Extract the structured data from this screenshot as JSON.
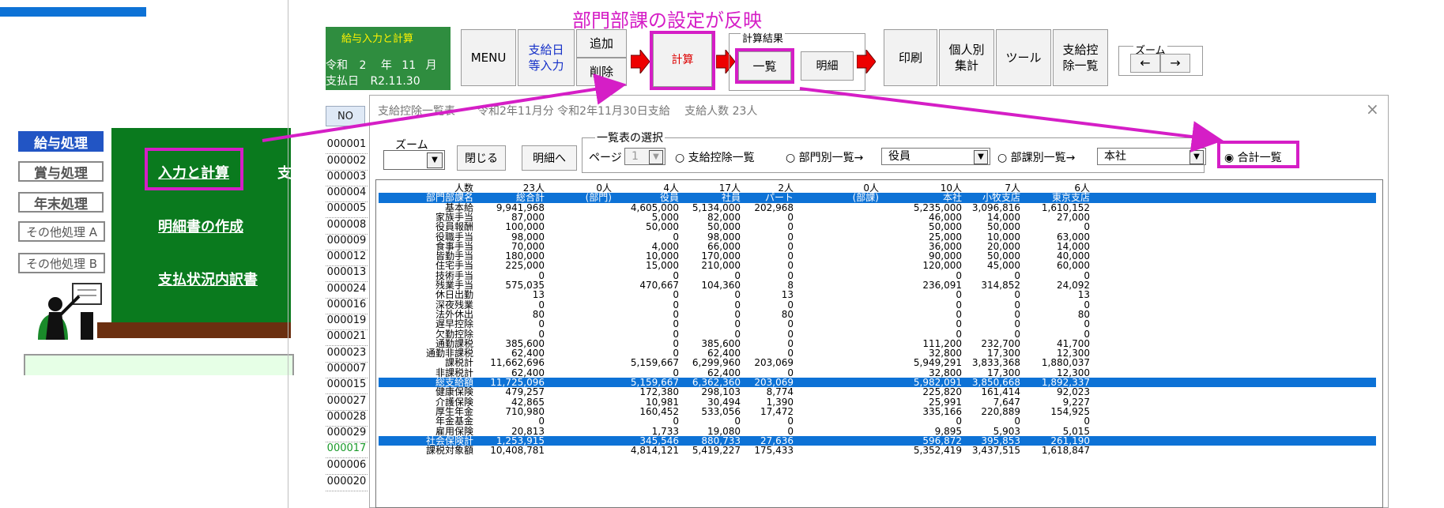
{
  "annotation": "部門部課の設定が反映",
  "left_menu": {
    "buttons": [
      "給与処理",
      "賞与処理",
      "年末処理",
      "その他処理 A",
      "その他処理 B"
    ],
    "links": [
      "入力と計算",
      "明細書の作成",
      "支払状況内訳書",
      "支"
    ]
  },
  "info_box": {
    "title": "給与入力と計算",
    "era": "令和",
    "year": "2",
    "year_unit": "年",
    "month": "11",
    "month_unit": "月",
    "paydate_label": "支払日",
    "paydate": "R2.11.30"
  },
  "toolbar": {
    "menu": "MENU",
    "payday_input": "支給日\n等入力",
    "add": "追加",
    "delete": "削除",
    "calc": "計算",
    "calc_result_label": "計算結果",
    "ichiran": "一覧",
    "meisai": "明細",
    "print": "印刷",
    "personal": "個人別\n集計",
    "tool": "ツール",
    "deduction_list": "支給控\n除一覧",
    "zoom_label": "ズーム",
    "zoom_left": "←",
    "zoom_right": "→"
  },
  "no_column": {
    "header": "NO",
    "items": [
      "000001",
      "000002",
      "000003",
      "000004",
      "000005",
      "000008",
      "000009",
      "000012",
      "000013",
      "000024",
      "000016",
      "000019",
      "000021",
      "000023",
      "000007",
      "000015",
      "000027",
      "000028",
      "000029",
      "000017",
      "000006",
      "000020"
    ]
  },
  "dialog": {
    "title": "支給控除一覧表　　令和2年11月分 令和2年11月30日支給　 支給人数 23人",
    "close": "×",
    "zoom_label": "ズーム",
    "close_btn": "閉じる",
    "detail_btn": "明細へ",
    "select_label": "一覧表の選択",
    "page_label": "ページ",
    "page_value": "1",
    "opt_list": "支給控除一覧",
    "opt_dept": "部門別一覧→",
    "dept_value": "役員",
    "opt_section": "部課別一覧→",
    "section_value": "本社",
    "opt_total": "合計一覧"
  },
  "table": {
    "rows": [
      {
        "name": "人数",
        "cells": [
          "23人",
          "0人",
          "4人",
          "17人",
          "2人",
          "0人",
          "10人",
          "7人",
          "6人"
        ],
        "blue": false
      },
      {
        "name": "部門部課名",
        "cells": [
          "総合計",
          "(部門)",
          "役員",
          "社員",
          "パート",
          "(部課)",
          "本社",
          "小牧支店",
          "東京支店"
        ],
        "blue": true
      },
      {
        "name": "基本給",
        "cells": [
          "9,941,968",
          "",
          "4,605,000",
          "5,134,000",
          "202,968",
          "",
          "5,235,000",
          "3,096,816",
          "1,610,152"
        ],
        "blue": false
      },
      {
        "name": "家族手当",
        "cells": [
          "87,000",
          "",
          "5,000",
          "82,000",
          "0",
          "",
          "46,000",
          "14,000",
          "27,000"
        ],
        "blue": false
      },
      {
        "name": "役員報酬",
        "cells": [
          "100,000",
          "",
          "50,000",
          "50,000",
          "0",
          "",
          "50,000",
          "50,000",
          "0"
        ],
        "blue": false
      },
      {
        "name": "役職手当",
        "cells": [
          "98,000",
          "",
          "0",
          "98,000",
          "0",
          "",
          "25,000",
          "10,000",
          "63,000"
        ],
        "blue": false
      },
      {
        "name": "食事手当",
        "cells": [
          "70,000",
          "",
          "4,000",
          "66,000",
          "0",
          "",
          "36,000",
          "20,000",
          "14,000"
        ],
        "blue": false
      },
      {
        "name": "皆勤手当",
        "cells": [
          "180,000",
          "",
          "10,000",
          "170,000",
          "0",
          "",
          "90,000",
          "50,000",
          "40,000"
        ],
        "blue": false
      },
      {
        "name": "住宅手当",
        "cells": [
          "225,000",
          "",
          "15,000",
          "210,000",
          "0",
          "",
          "120,000",
          "45,000",
          "60,000"
        ],
        "blue": false
      },
      {
        "name": "技術手当",
        "cells": [
          "0",
          "",
          "0",
          "0",
          "0",
          "",
          "0",
          "0",
          "0"
        ],
        "blue": false
      },
      {
        "name": "残業手当",
        "cells": [
          "575,035",
          "",
          "470,667",
          "104,360",
          "8",
          "",
          "236,091",
          "314,852",
          "24,092"
        ],
        "blue": false
      },
      {
        "name": "休日出勤",
        "cells": [
          "13",
          "",
          "0",
          "0",
          "13",
          "",
          "0",
          "0",
          "13"
        ],
        "blue": false
      },
      {
        "name": "深夜残業",
        "cells": [
          "0",
          "",
          "0",
          "0",
          "0",
          "",
          "0",
          "0",
          "0"
        ],
        "blue": false
      },
      {
        "name": "法外休出",
        "cells": [
          "80",
          "",
          "0",
          "0",
          "80",
          "",
          "0",
          "0",
          "80"
        ],
        "blue": false
      },
      {
        "name": "遅早控除",
        "cells": [
          "0",
          "",
          "0",
          "0",
          "0",
          "",
          "0",
          "0",
          "0"
        ],
        "blue": false
      },
      {
        "name": "欠勤控除",
        "cells": [
          "0",
          "",
          "0",
          "0",
          "0",
          "",
          "0",
          "0",
          "0"
        ],
        "blue": false
      },
      {
        "name": "通勤課税",
        "cells": [
          "385,600",
          "",
          "0",
          "385,600",
          "0",
          "",
          "111,200",
          "232,700",
          "41,700"
        ],
        "blue": false
      },
      {
        "name": "通勤非課税",
        "cells": [
          "62,400",
          "",
          "0",
          "62,400",
          "0",
          "",
          "32,800",
          "17,300",
          "12,300"
        ],
        "blue": false
      },
      {
        "name": "課税計",
        "cells": [
          "11,662,696",
          "",
          "5,159,667",
          "6,299,960",
          "203,069",
          "",
          "5,949,291",
          "3,833,368",
          "1,880,037"
        ],
        "blue": false
      },
      {
        "name": "非課税計",
        "cells": [
          "62,400",
          "",
          "0",
          "62,400",
          "0",
          "",
          "32,800",
          "17,300",
          "12,300"
        ],
        "blue": false
      },
      {
        "name": "総支給額",
        "cells": [
          "11,725,096",
          "",
          "5,159,667",
          "6,362,360",
          "203,069",
          "",
          "5,982,091",
          "3,850,668",
          "1,892,337"
        ],
        "blue": true
      },
      {
        "name": "健康保険",
        "cells": [
          "479,257",
          "",
          "172,380",
          "298,103",
          "8,774",
          "",
          "225,820",
          "161,414",
          "92,023"
        ],
        "blue": false
      },
      {
        "name": "介護保険",
        "cells": [
          "42,865",
          "",
          "10,981",
          "30,494",
          "1,390",
          "",
          "25,991",
          "7,647",
          "9,227"
        ],
        "blue": false
      },
      {
        "name": "厚生年金",
        "cells": [
          "710,980",
          "",
          "160,452",
          "533,056",
          "17,472",
          "",
          "335,166",
          "220,889",
          "154,925"
        ],
        "blue": false
      },
      {
        "name": "年金基金",
        "cells": [
          "0",
          "",
          "0",
          "0",
          "0",
          "",
          "0",
          "0",
          "0"
        ],
        "blue": false
      },
      {
        "name": "雇用保険",
        "cells": [
          "20,813",
          "",
          "1,733",
          "19,080",
          "0",
          "",
          "9,895",
          "5,903",
          "5,015"
        ],
        "blue": false
      },
      {
        "name": "社会保険計",
        "cells": [
          "1,253,915",
          "",
          "345,546",
          "880,733",
          "27,636",
          "",
          "596,872",
          "395,853",
          "261,190"
        ],
        "blue": true
      },
      {
        "name": "課税対象額",
        "cells": [
          "10,408,781",
          "",
          "4,814,121",
          "5,419,227",
          "175,433",
          "",
          "5,352,419",
          "3,437,515",
          "1,618,847"
        ],
        "blue": false
      }
    ]
  },
  "colors": {
    "highlight": "#d51ec6",
    "table_blue": "#0d72d6",
    "menu_green": "#0a7a1e",
    "info_green": "#2f8d3f",
    "active_nav": "#2255c4"
  }
}
